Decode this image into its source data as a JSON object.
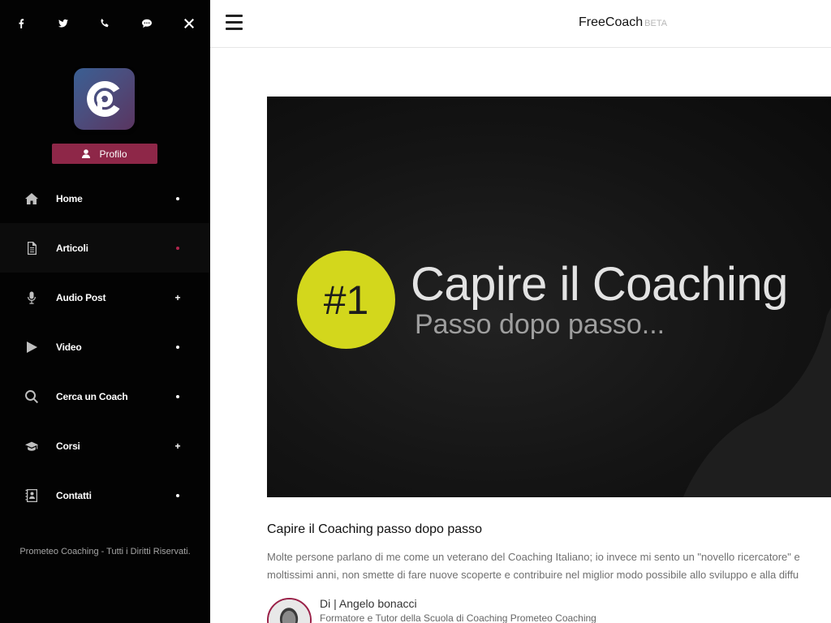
{
  "social_icons": [
    "facebook-icon",
    "twitter-icon",
    "phone-icon",
    "chat-icon",
    "close-icon"
  ],
  "profile_label": "Profilo",
  "nav": [
    {
      "label": "Home",
      "icon": "home-icon",
      "marker": "dot",
      "active": false
    },
    {
      "label": "Articoli",
      "icon": "document-icon",
      "marker": "dot",
      "active": true
    },
    {
      "label": "Audio Post",
      "icon": "microphone-icon",
      "marker": "+",
      "active": false
    },
    {
      "label": "Video",
      "icon": "play-icon",
      "marker": "dot",
      "active": false
    },
    {
      "label": "Cerca un Coach",
      "icon": "search-icon",
      "marker": "dot",
      "active": false
    },
    {
      "label": "Corsi",
      "icon": "graduation-cap-icon",
      "marker": "+",
      "active": false
    },
    {
      "label": "Contatti",
      "icon": "contact-book-icon",
      "marker": "dot",
      "active": false
    }
  ],
  "footer": "Prometeo Coaching - Tutti i Diritti Riservati.",
  "header": {
    "brand": "FreeCoach",
    "beta": "BETA"
  },
  "hero": {
    "badge": "#1",
    "title": "Capire il Coaching",
    "subtitle": "Passo dopo passo..."
  },
  "post": {
    "title": "Capire il Coaching passo dopo passo",
    "excerpt_line1": "Molte persone parlano di me come un veterano del Coaching Italiano; io invece mi sento un \"novello ricercatore\" e",
    "excerpt_line2": "moltissimi anni, non smette di fare nuove scoperte e contribuire nel miglior modo possibile allo sviluppo e alla diffu",
    "author_name": "Di | Angelo bonacci",
    "author_role": "Formatore e Tutor della Scuola di Coaching Prometeo Coaching"
  },
  "colors": {
    "accent": "#8e2748",
    "sidebar": "#030303",
    "badge": "#d3d71c"
  }
}
